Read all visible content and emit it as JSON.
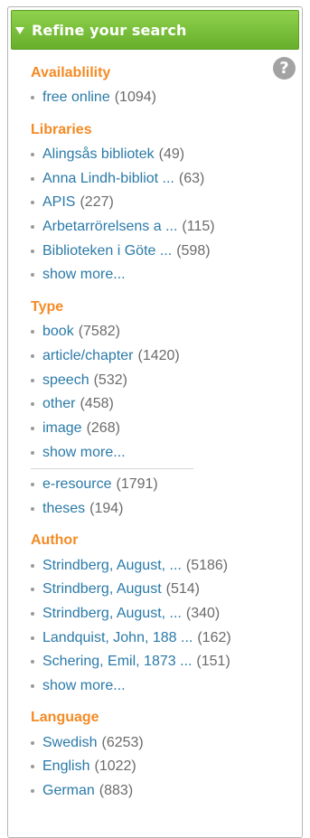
{
  "header": {
    "title": "Refine your search"
  },
  "sections": {
    "availability": {
      "title": "Availablility",
      "items": [
        {
          "label": "free online",
          "count": "(1094)"
        }
      ]
    },
    "libraries": {
      "title": "Libraries",
      "items": [
        {
          "label": "Alingsås bibliotek",
          "count": "(49)"
        },
        {
          "label": "Anna Lindh-bibliot ...",
          "count": "(63)"
        },
        {
          "label": "APIS",
          "count": "(227)"
        },
        {
          "label": "Arbetarrörelsens a ...",
          "count": "(115)"
        },
        {
          "label": "Biblioteken i Göte ...",
          "count": "(598)"
        }
      ],
      "show_more": "show more..."
    },
    "type": {
      "title": "Type",
      "items": [
        {
          "label": "book",
          "count": "(7582)"
        },
        {
          "label": "article/chapter",
          "count": "(1420)"
        },
        {
          "label": "speech",
          "count": "(532)"
        },
        {
          "label": "other",
          "count": "(458)"
        },
        {
          "label": "image",
          "count": "(268)"
        }
      ],
      "show_more": "show more...",
      "extra_items": [
        {
          "label": "e-resource",
          "count": "(1791)"
        },
        {
          "label": "theses",
          "count": "(194)"
        }
      ]
    },
    "author": {
      "title": "Author",
      "items": [
        {
          "label": "Strindberg, August, ...",
          "count": "(5186)"
        },
        {
          "label": "Strindberg, August",
          "count": "(514)"
        },
        {
          "label": "Strindberg, August, ...",
          "count": "(340)"
        },
        {
          "label": "Landquist, John, 188 ...",
          "count": "(162)"
        },
        {
          "label": "Schering, Emil, 1873 ...",
          "count": "(151)"
        }
      ],
      "show_more": "show more..."
    },
    "language": {
      "title": "Language",
      "items": [
        {
          "label": "Swedish",
          "count": "(6253)"
        },
        {
          "label": "English",
          "count": "(1022)"
        },
        {
          "label": "German",
          "count": "(883)"
        }
      ]
    }
  },
  "help": {
    "glyph": "?"
  },
  "colors": {
    "header_green": "#6fb534",
    "section_orange": "#f48b25",
    "link_blue": "#2a7aa8"
  }
}
